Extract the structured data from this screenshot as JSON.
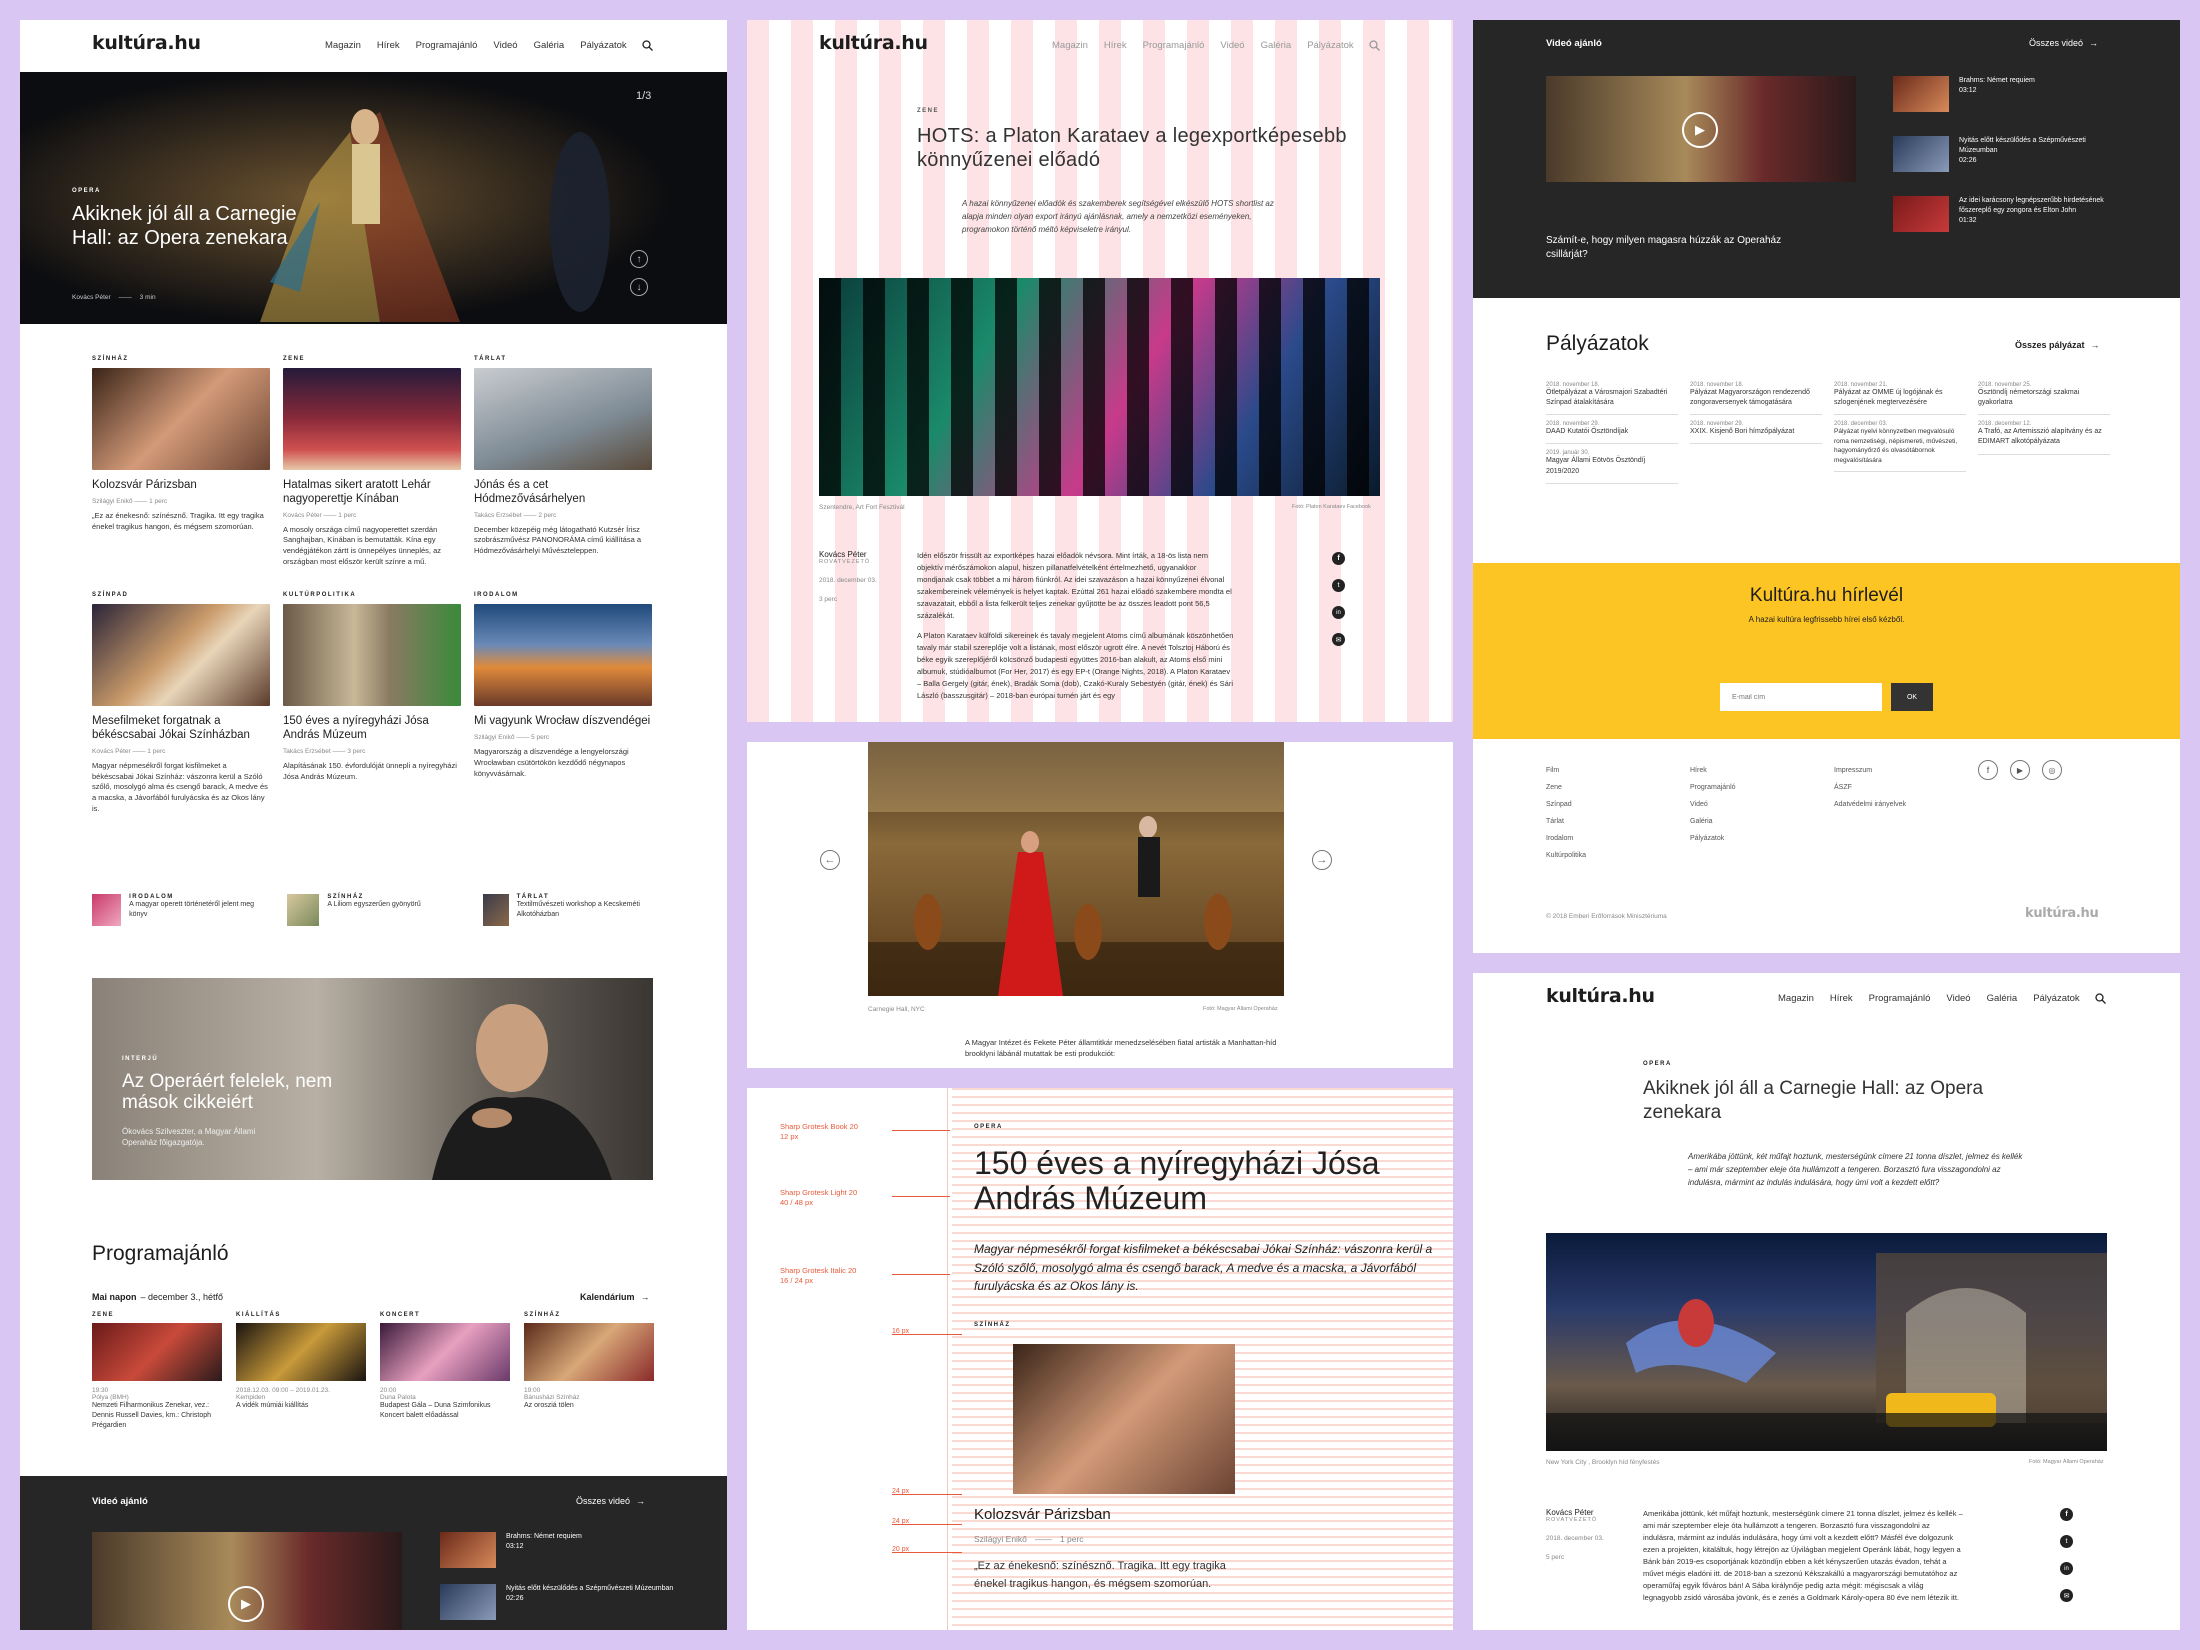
{
  "logo": "kultúra.hu",
  "nav": [
    "Magazin",
    "Hírek",
    "Programajánló",
    "Videó",
    "Galéria",
    "Pályázatok"
  ],
  "p1": {
    "hero": {
      "counter": "1/3",
      "kicker": "OPERA",
      "title": "Akiknek jól áll a Carnegie Hall: az Opera zenekara",
      "author": "Kovács Péter",
      "read": "3 min"
    },
    "cards": [
      {
        "kicker": "SZÍNHÁZ",
        "title": "Kolozsvár Párizsban",
        "author": "Szilágyi Enikő",
        "read": "1 perc",
        "text": "„Ez az énekesnő: színésznő. Tragika. Itt egy tragika énekel tragikus hangon, és mégsem szomorúan."
      },
      {
        "kicker": "ZENE",
        "title": "Hatalmas sikert aratott Lehár nagyoperettje Kínában",
        "author": "Kovács Péter",
        "read": "1 perc",
        "text": "A mosoly országa című nagyoperettet szerdán Sanghajban, Kínában is bemutatták. Kína egy vendégjátékon zártt is ünnepélyes ünneplés, az országban most először került színre a mű."
      },
      {
        "kicker": "TÁRLAT",
        "title": "Jónás és a cet Hódmezővásárhelyen",
        "author": "Takács Erzsébet",
        "read": "2 perc",
        "text": "December közepéig még látogatható Kutzsér Írisz szobrászművész PANONORÁMA című kiállítása a Hódmezővásárhelyi Művészteleppen."
      },
      {
        "kicker": "SZÍNPAD",
        "title": "Mesefilmeket forgatnak a békéscsabai Jókai Színházban",
        "author": "Kovács Péter",
        "read": "1 perc",
        "text": "Magyar népmesékről forgat kisfilmeket a békéscsabai Jókai Színház: vászonra kerül a Szóló szőlő, mosolygó alma és csengő barack, A medve és a macska, a Jávorfából furulyácska és az Okos lány is."
      },
      {
        "kicker": "KULTÚRPOLITIKA",
        "title": "150 éves a nyíregyházi Jósa András Múzeum",
        "author": "Takács Erzsébet",
        "read": "3 perc",
        "text": "Alapításának 150. évfordulóját ünnepli a nyíregyházi Jósa András Múzeum."
      },
      {
        "kicker": "IRODALOM",
        "title": "Mi vagyunk Wrocław díszvendégei",
        "author": "Szilágyi Enikő",
        "read": "5 perc",
        "text": "Magyarország a díszvendége a lengyelországi Wrocławban csütörtökön kezdődő négynapos könyvvásárnak."
      }
    ],
    "mini": [
      {
        "kicker": "IRODALOM",
        "text": "A magyar operett történetéről jelent meg könyv"
      },
      {
        "kicker": "SZÍNHÁZ",
        "text": "A Liliom egyszerűen gyönyörű"
      },
      {
        "kicker": "TÁRLAT",
        "text": "Textilművészeti workshop a Kecskeméti Alkotóházban"
      }
    ],
    "interview": {
      "kicker": "INTERJÚ",
      "title": "Az Operáért felelek, nem mások cikkeiért",
      "sub": "Ókovács Szilveszter, a Magyar Állami Operaház főigazgatója."
    },
    "program": {
      "title": "Programajánló",
      "day": "Mai napon",
      "date": "– december 3., hétfő",
      "cal": "Kalendárium",
      "items": [
        {
          "kicker": "ZENE",
          "time": "19:30",
          "place": "Pólya (BMH)",
          "text": "Nemzeti Filharmonikus Zenekar, vez.: Dennis Russell Davies, km.: Christoph Prégardien"
        },
        {
          "kicker": "KIÁLLÍTÁS",
          "time": "2018.12.03. 09:00 – 2019.01.23.",
          "place": "Kempiden",
          "text": "A vidék múmiái kiállítás"
        },
        {
          "kicker": "KONCERT",
          "time": "20:00",
          "place": "Duna Palota",
          "text": "Budapest Gála – Duna Szimfonikus Koncert balett előadással"
        },
        {
          "kicker": "SZÍNHÁZ",
          "time": "19:00",
          "place": "Bánusházi Színház",
          "text": "Az orosziá tölen"
        }
      ]
    },
    "video": {
      "title": "Videó ajánló",
      "all": "Összes videó",
      "items": [
        {
          "title": "Brahms: Német requiem",
          "dur": "03:12"
        },
        {
          "title": "Nyitás előtt készülődés a Szépművészeti Múzeumban",
          "dur": "02:26"
        }
      ]
    }
  },
  "p2": {
    "kicker": "ZENE",
    "title": "HOTS: a Platon Karataev a legexportképesebb könnyűzenei előadó",
    "lead": "A hazai könnyűzenei előadók és szakemberek segítségével elkészülő HOTS shortlist az alapja minden olyan export irányú ajánlásnak, amely a nemzetközi eseményeken, programokon történő méltó képviseletre irányul.",
    "caption": "Szentendre, Art Fort Fesztivál",
    "credit": "Fotó: Platon Karataev Facebook",
    "author": "Kovács Péter",
    "role": "RovatVezető",
    "date": "2018. december 03.",
    "read": "3 perc",
    "p1": "Idén először frissült az exportképes hazai előadók névsora. Mint írták, a 18-ös lista nem objektív mérőszámokon alapul, hiszen pillanatfelvételként értelmezhető, ugyanakkor mondjanak csak többet a mi három fiúnkról. Az idei szavazáson a hazai könnyűzenei élvonal szakembereinek vélemények is helyet kaptak. Ezúttal 261 hazai előadó szakembere mondta el szavazatait, ebből a lista felkerült teljes zenekar gyűjtötte be az összes leadott pont 56,5 százalékát.",
    "p2": "A Platon Karataev külföldi sikereinek és tavaly megjelent Atoms című albumának köszönhetően tavaly már stabil szereplője volt a listának, most először ugrott élre. A nevét Tolsztoj Háború és béke egyik szereplőjéről kölcsönző budapesti együttes 2016-ban alakult, az Atoms első mini albumuk, stúdióalbumot (For Her, 2017) és egy EP-t (Orange Nights, 2018). A Platon Karataev – Balla Gergely (gitár, ének), Bradák Soma (dob), Czakó-Kuraly Sebestyén (gitár, ének) és Sári László (basszusgitár) – 2018-ban európai turnén járt és egy"
  },
  "p3": {
    "caption": "Carnegie Hall, NYC",
    "credit": "Fotó: Magyar Állami Operaház",
    "text": "A Magyar Intézet és Fekete Péter államtitkár menedzselésében fiatal artisták a Manhattan-híd brooklyni lábánál mutattak be esti produkciót:"
  },
  "p4": {
    "specs": [
      {
        "name": "Sharp Grotesk Book 20",
        "size": "12 px"
      },
      {
        "name": "Sharp Grotesk Light 20",
        "size": "40 / 48 px"
      },
      {
        "name": "Sharp Grotesk Italic 20",
        "size": "16 / 24 px"
      }
    ],
    "kicker": "OPERA",
    "title": "150 éves a nyíregyházi Jósa András Múzeum",
    "lead": "Magyar népmesékről forgat kisfilmeket a békéscsabai Jókai Színház: vászonra kerül a Szóló szőlő, mosolygó alma és csengő barack, A medve és a macska, a Jávorfából furulyácska és az Okos lány is.",
    "card_kicker": "SZÍNHÁZ",
    "card_title": "Kolozsvár Párizsban",
    "card_author": "Szilágyi Enikő",
    "card_read": "1 perc",
    "card_text": "„Ez az énekesnő: színésznő. Tragika. Itt egy tragika énekel tragikus hangon, és mégsem szomorúan.",
    "marks": [
      "16 px",
      "24 px",
      "24 px",
      "20 px"
    ]
  },
  "p5": {
    "video": {
      "title": "Videó ajánló",
      "all": "Összes videó",
      "main": "Számít-e, hogy milyen magasra húzzák az Operaház csillárját?",
      "items": [
        {
          "title": "Brahms: Német requiem",
          "dur": "03:12"
        },
        {
          "title": "Nyitás előtt készülődés a Szépművészeti Múzeumban",
          "dur": "02:26"
        },
        {
          "title": "Az idei karácsony legnépszerűbb hirdetésének főszereplő egy zongora és Elton John",
          "dur": "01:32"
        }
      ]
    },
    "pal": {
      "title": "Pályázatok",
      "all": "Összes pályázat",
      "cols": [
        [
          {
            "date": "2018. november 18.",
            "text": "Ötletpályázat a Városmajori Szabadtéri Színpad átalakítására"
          },
          {
            "date": "2018. november 29.",
            "text": "DAAD Kutatói Ösztöndíjak"
          },
          {
            "date": "2019. január 30.",
            "text": "Magyar Állami Eötvös Ösztöndíj 2019/2020"
          }
        ],
        [
          {
            "date": "2018. november 18.",
            "text": "Pályázat Magyarországon rendezendő zongoraversenyek támogatására"
          },
          {
            "date": "2018. november 29.",
            "text": "XXIX. Kisjenő Bori hímzőpályázat"
          }
        ],
        [
          {
            "date": "2018. november 21.",
            "text": "Pályázat az OMME új logójának és szlogenjének megtervezésére"
          },
          {
            "date": "2018. december 03.",
            "text": "Pályázat nyelvi könnyzetben megvalósuló roma nemzetiségi, népismereti, művészeti, hagyományőrző és olvasótábornok megvalósítására"
          }
        ],
        [
          {
            "date": "2018. november 25.",
            "text": "Ösztöndíj németországi szakmai gyakorlatra"
          },
          {
            "date": "2018. december 12.",
            "text": "A Trafó, az Artemisszió alapítvány és az EDIMART alkotópályázata"
          }
        ]
      ]
    },
    "news": {
      "title": "Kultúra.hu hírlevél",
      "sub": "A hazai kultúra legfrissebb hírei első kézből.",
      "placeholder": "E-mail cím",
      "ok": "OK"
    },
    "footer": {
      "c1": [
        "Film",
        "Zene",
        "Színpad",
        "Tárlat",
        "Irodalom",
        "Kultúrpolitika"
      ],
      "c2": [
        "Hírek",
        "Programajánló",
        "Videó",
        "Galéria",
        "Pályázatok"
      ],
      "c3": [
        "Impresszum",
        "ÁSZF",
        "Adatvédelmi irányelvek"
      ],
      "copy": "© 2018 Emberi Erőforrások Minisztériuma",
      "logo": "kultúra.hu"
    }
  },
  "p6": {
    "kicker": "OPERA",
    "title": "Akiknek jól áll a Carnegie Hall: az Opera zenekara",
    "lead": "Amerikába jöttünk, két műfajt hoztunk, mesterségünk címere 21 tonna díszlet, jelmez és kellék – ami már szeptember eleje óta hullámzott a tengeren. Borzasztó fura visszagondolni az indulásra, mármint az indulás indulására, hogy úmi volt a kezdett előtt?",
    "caption": "New York City , Brooklyn híd fényfestés",
    "credit": "Fotó: Magyar Állami Operaház",
    "author": "Kovács Péter",
    "role": "RovatVezető",
    "date": "2018. december 03.",
    "read": "5 perc",
    "body": "Amerikába jöttünk, két műfajt hoztunk, mesterségünk címere 21 tonna díszlet, jelmez és kellék – ami már szeptember eleje óta hullámzott a tengeren. Borzasztó fura visszagondolni az indulásra, mármint az indulás indulására, hogy úmi volt a kezdett előtt? Másfél éve dolgozunk ezen a projekten, kitaláltuk, hogy létrejön az Újvilágban megjelent Operánk lábát, hogy legyen a Bánk bán 2019-es csoportjának közöndíjn ebben a két kényszerűen utazás évadon, tehát a művet mégis eladóni itt. de 2018-ban a szezonú Kékszakállú a magyarországi bemutatóhoz az operaműfaj egyik főváros bán! A Sába királynője pedig azta mégit: mégiscsak a világ legnagyobb zsidó városába jövünk, és e zenés a Goldmark Károly-opera 80 éve nem létezik itt."
  }
}
